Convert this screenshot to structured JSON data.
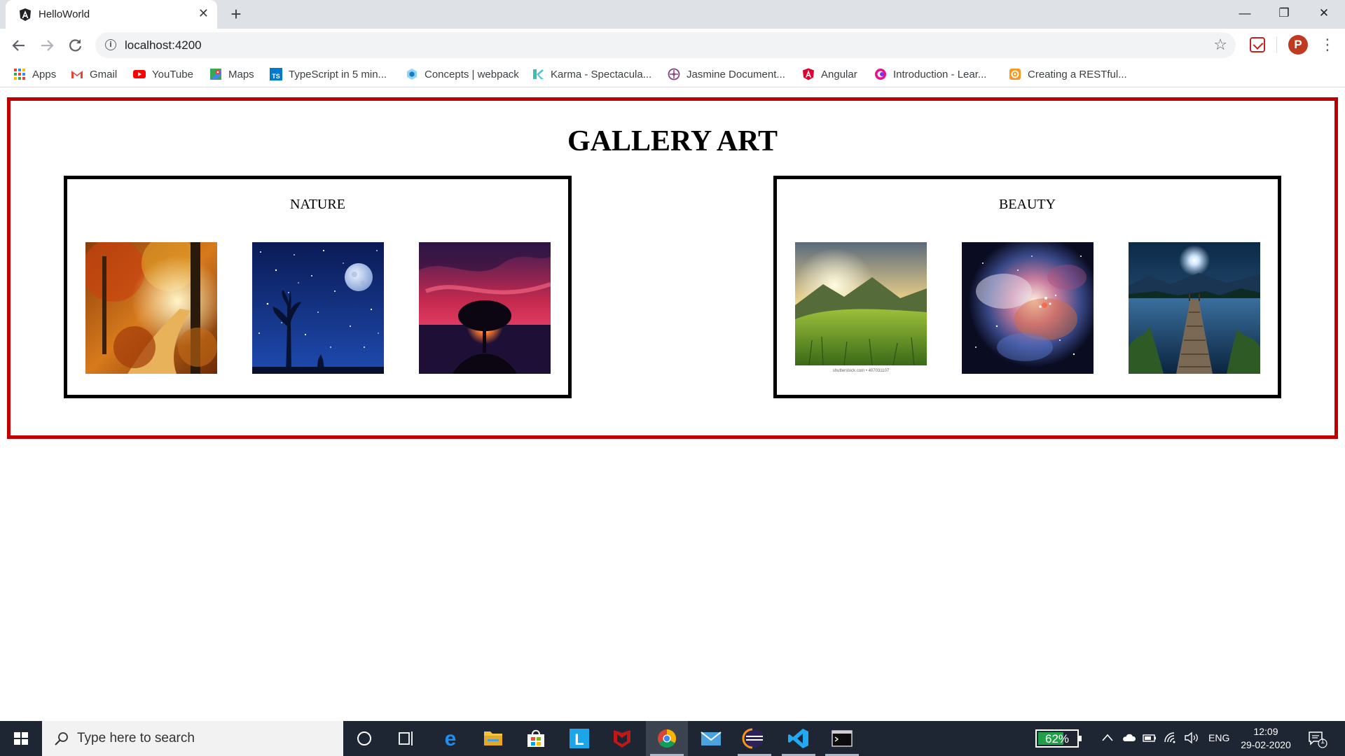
{
  "browser": {
    "tab_title": "HelloWorld",
    "tab_close": "✕",
    "new_tab": "+",
    "url": "localhost:4200",
    "window_controls": {
      "minimize": "—",
      "restore": "❐",
      "close": "✕"
    },
    "avatar_letter": "P"
  },
  "bookmarks": [
    {
      "label": "Apps",
      "icon": "apps-grid-icon"
    },
    {
      "label": "Gmail",
      "icon": "gmail-icon"
    },
    {
      "label": "YouTube",
      "icon": "youtube-icon"
    },
    {
      "label": "Maps",
      "icon": "maps-icon"
    },
    {
      "label": "TypeScript in 5 min...",
      "icon": "typescript-icon"
    },
    {
      "label": "Concepts | webpack",
      "icon": "webpack-icon"
    },
    {
      "label": "Karma - Spectacula...",
      "icon": "karma-icon"
    },
    {
      "label": "Jasmine Document...",
      "icon": "jasmine-icon"
    },
    {
      "label": "Angular",
      "icon": "angular-icon"
    },
    {
      "label": "Introduction - Lear...",
      "icon": "learn-icon"
    },
    {
      "label": "Creating a RESTful...",
      "icon": "restful-icon"
    }
  ],
  "page": {
    "title": "GALLERY ART",
    "frame_color": "#c00000",
    "sections": [
      {
        "title": "NATURE",
        "images": [
          "autumn-forest-path",
          "starry-night-moon-tree",
          "sunset-tree-silhouette"
        ]
      },
      {
        "title": "BEAUTY",
        "images": [
          "mountain-meadow-sunrise",
          "galaxy-nebula",
          "lake-pier-moonlight"
        ]
      }
    ],
    "watermark": "shutterstock.com • 407031107"
  },
  "taskbar": {
    "search_placeholder": "Type here to search",
    "battery_percent": "62%",
    "language": "ENG",
    "time": "12:09",
    "date": "29-02-2020",
    "notification_count": "1"
  }
}
